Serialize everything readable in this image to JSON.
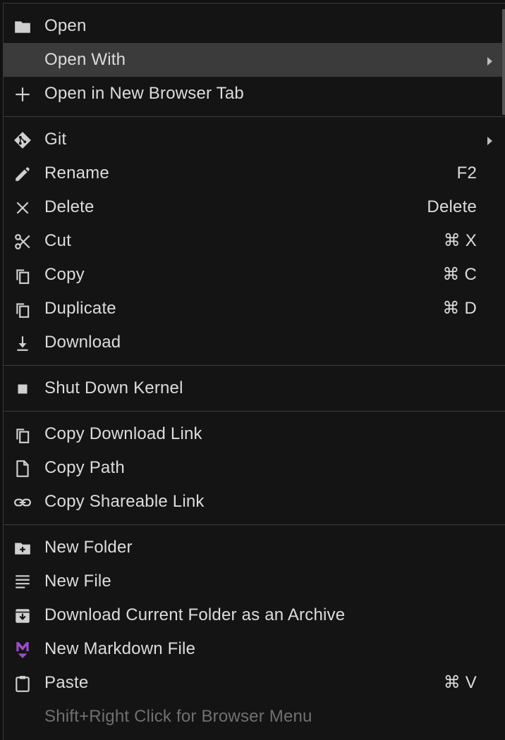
{
  "menu": {
    "items": {
      "open": {
        "label": "Open"
      },
      "open_with": {
        "label": "Open With"
      },
      "open_new_tab": {
        "label": "Open in New Browser Tab"
      },
      "git": {
        "label": "Git"
      },
      "rename": {
        "label": "Rename",
        "shortcut": "F2"
      },
      "delete": {
        "label": "Delete",
        "shortcut": "Delete"
      },
      "cut": {
        "label": "Cut",
        "shortcut": "⌘ X"
      },
      "copy": {
        "label": "Copy",
        "shortcut": "⌘ C"
      },
      "duplicate": {
        "label": "Duplicate",
        "shortcut": "⌘ D"
      },
      "download": {
        "label": "Download"
      },
      "shutdown_kernel": {
        "label": "Shut Down Kernel"
      },
      "copy_download_link": {
        "label": "Copy Download Link"
      },
      "copy_path": {
        "label": "Copy Path"
      },
      "copy_shareable_link": {
        "label": "Copy Shareable Link"
      },
      "new_folder": {
        "label": "New Folder"
      },
      "new_file": {
        "label": "New File"
      },
      "download_folder_archive": {
        "label": "Download Current Folder as an Archive"
      },
      "new_markdown_file": {
        "label": "New Markdown File"
      },
      "paste": {
        "label": "Paste",
        "shortcut": "⌘ V"
      },
      "browser_menu_hint": {
        "label": "Shift+Right Click for Browser Menu"
      }
    }
  },
  "colors": {
    "background": "#141414",
    "active_row": "#3b3b3b",
    "text": "#dcdcdc",
    "disabled_text": "#707070",
    "markdown_icon": "#9b4dca"
  }
}
